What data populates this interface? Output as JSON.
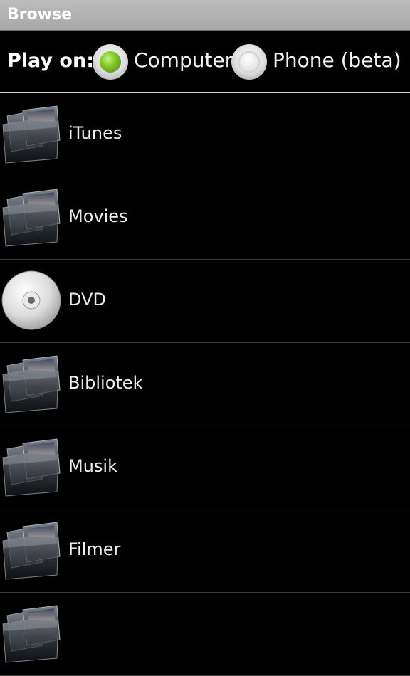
{
  "title_bar": {
    "title": "Browse"
  },
  "play_on": {
    "label": "Play on:",
    "options": [
      {
        "label": "Computer",
        "checked": true
      },
      {
        "label": "Phone (beta)",
        "checked": false
      }
    ]
  },
  "list": {
    "items": [
      {
        "label": "iTunes",
        "icon": "photo-folder-icon"
      },
      {
        "label": "Movies",
        "icon": "photo-folder-icon"
      },
      {
        "label": "DVD",
        "icon": "dvd-disc-icon"
      },
      {
        "label": "Bibliotek",
        "icon": "photo-folder-icon"
      },
      {
        "label": "Musik",
        "icon": "photo-folder-icon"
      },
      {
        "label": "Filmer",
        "icon": "photo-folder-icon"
      },
      {
        "label": "",
        "icon": "photo-folder-icon"
      }
    ]
  },
  "colors": {
    "background": "#000000",
    "title_bar": "#b3b3b3",
    "radio_selected": "#7cc224",
    "divider": "#3a3a3a"
  }
}
